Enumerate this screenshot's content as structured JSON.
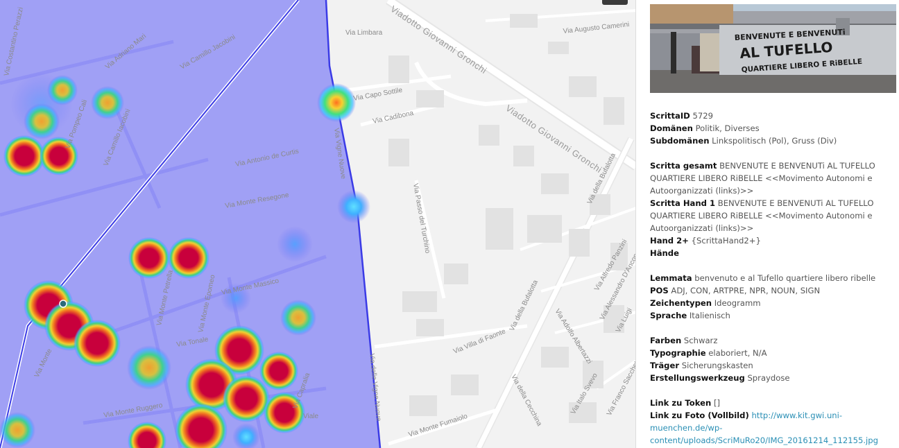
{
  "map": {
    "street_labels": [
      "Via Costantino Perazzi",
      "Via Adriano Mari",
      "Via Camillo Jacobini",
      "Via Antonio de Curtis",
      "Via Pompeo Cali",
      "Via Camillo Iacobini",
      "Via Limbara",
      "Viadotto Giovanni Gronchi",
      "Via Augusto Camerini",
      "Via Capo Sottile",
      "Via Cadibona",
      "Viadotto Giovanni Gronchi",
      "Via della Bufalotta",
      "Via Monte Resegone",
      "Via Passo del Turchino",
      "Via Monte Massico",
      "Via Monte Petrella",
      "Via Monte Epomeo",
      "Via Monte Ruggero",
      "Via Monte Fumaiolo",
      "Via Villa di Faonte",
      "Via della Bufalotta",
      "Via della Cecchina",
      "Via Italo Svevo",
      "Via Alfredo Panzini",
      "Via Adolfo Albertazzi",
      "Via Alessandro D'Ancona",
      "Via Franco Sacchetti",
      "Via Luigi",
      "Via Tonale",
      "Via Monte",
      "Via Capralia",
      "Viale",
      "Via Vigne Nuove",
      "Via delle Vigne Nuove"
    ],
    "colors": {
      "overlay": "#6e6ef7",
      "boundary": "#3b3be6",
      "heat_hot": "#c8003c",
      "heat_warm": "#f0c020",
      "heat_cool": "#40c8ff"
    }
  },
  "photo": {
    "graffiti_lines": [
      "BENVENUTE E BENVENUTi",
      "AL TUFELLO",
      "QUARTIERE LIBERO E RiBELLE"
    ]
  },
  "info": {
    "scritta_id": {
      "label": "ScrittaID",
      "value": "5729"
    },
    "domaenen": {
      "label": "Domänen",
      "value": "Politik, Diverses"
    },
    "subdomaenen": {
      "label": "Subdomänen",
      "value": "Linkspolitisch (Pol), Gruss (Div)"
    },
    "scritta_gesamt": {
      "label": "Scritta gesamt",
      "value": "BENVENUTE E BENVENUTi AL TUFELLO QUARTIERE LIBERO RiBELLE <<Movimento Autonomi e Autoorganizzati (links)>>"
    },
    "scritta_hand1": {
      "label": "Scritta Hand 1",
      "value": "BENVENUTE E BENVENUTi AL TUFELLO QUARTIERE LIBERO RiBELLE <<Movimento Autonomi e Autoorganizzati (links)>>"
    },
    "hand2": {
      "label": "Hand 2+",
      "value": "{ScrittaHand2+}"
    },
    "haende": {
      "label": "Hände",
      "value": ""
    },
    "lemmata": {
      "label": "Lemmata",
      "value": "benvenuto e al Tufello quartiere libero ribelle"
    },
    "pos": {
      "label": "POS",
      "value": "ADJ, CON, ARTPRE, NPR, NOUN, SIGN"
    },
    "zeichentypen": {
      "label": "Zeichentypen",
      "value": "Ideogramm"
    },
    "sprache": {
      "label": "Sprache",
      "value": "Italienisch"
    },
    "farben": {
      "label": "Farben",
      "value": "Schwarz"
    },
    "typographie": {
      "label": "Typographie",
      "value": "elaboriert, N/A"
    },
    "traeger": {
      "label": "Träger",
      "value": "Sicherungskasten"
    },
    "werkzeug": {
      "label": "Erstellungswerkzeug",
      "value": "Spraydose"
    },
    "link_token": {
      "label": "Link zu Token",
      "value": "[]"
    },
    "link_foto": {
      "label": "Link zu Foto (Vollbild)",
      "value": "http://www.kit.gwi.uni-muenchen.de/wp-content/uploads/ScriMuRo20/IMG_20161214_112155.jpg"
    }
  }
}
